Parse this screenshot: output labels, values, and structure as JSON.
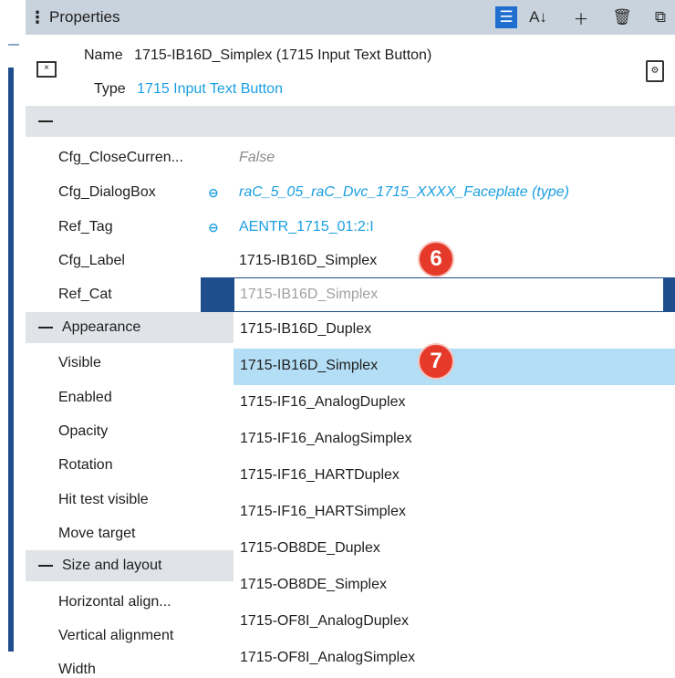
{
  "panel": {
    "title": "Properties"
  },
  "header": {
    "name_key": "Name",
    "name_value": "1715-IB16D_Simplex (1715 Input Text Button)",
    "type_key": "Type",
    "type_value": "1715 Input Text Button"
  },
  "properties": [
    {
      "label": "Cfg_CloseCurren...",
      "value": "False"
    },
    {
      "label": "Cfg_DialogBox",
      "value": "raC_5_05_raC_Dvc_1715_XXXX_Faceplate (type)"
    },
    {
      "label": "Ref_Tag",
      "value": "AENTR_1715_01:2:I"
    },
    {
      "label": "Cfg_Label",
      "value": "1715-IB16D_Simplex"
    },
    {
      "label": "Ref_Cat",
      "value": ""
    }
  ],
  "sections": {
    "appearance": "Appearance",
    "size_layout": "Size and layout"
  },
  "appearance_items": [
    "Visible",
    "Enabled",
    "Opacity",
    "Rotation",
    "Hit test visible",
    "Move target"
  ],
  "layout_items": [
    "Horizontal align...",
    "Vertical alignment",
    "Width"
  ],
  "combo": {
    "placeholder": "1715-IB16D_Simplex"
  },
  "dropdown": {
    "options": [
      "1715-IB16D_Duplex",
      "1715-IB16D_Simplex",
      "1715-IF16_AnalogDuplex",
      "1715-IF16_AnalogSimplex",
      "1715-IF16_HARTDuplex",
      "1715-IF16_HARTSimplex",
      "1715-OB8DE_Duplex",
      "1715-OB8DE_Simplex",
      "1715-OF8I_AnalogDuplex",
      "1715-OF8I_AnalogSimplex"
    ],
    "selected": "1715-IB16D_Simplex"
  },
  "badges": {
    "step6": "6",
    "step7": "7"
  },
  "icons": {
    "toolbar": [
      "filter-icon",
      "sort-az-icon",
      "add-icon",
      "delete-icon",
      "copy-icon"
    ],
    "accent_color": "#1f6fd1",
    "link_color": "#1a9fe0",
    "badge_color": "#e53a2a",
    "selected_color": "#b3def5"
  }
}
